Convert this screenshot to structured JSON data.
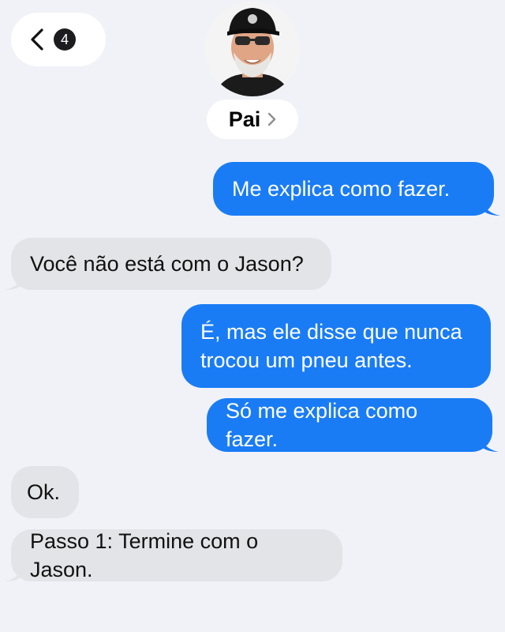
{
  "header": {
    "unread_count": "4",
    "contact_name": "Pai"
  },
  "icons": {
    "back": "chevron-left-icon",
    "contact_details": "chevron-right-icon"
  },
  "colors": {
    "sent_bubble": "#1a7cf5",
    "received_bubble": "#e3e4e8",
    "background": "#f1f2f7"
  },
  "messages": [
    {
      "direction": "sent",
      "text": "Me explica como fazer."
    },
    {
      "direction": "received",
      "text": "Você não está com o Jason?"
    },
    {
      "direction": "sent",
      "lines": [
        "É, mas ele disse que nunca",
        "trocou um pneu antes."
      ]
    },
    {
      "direction": "sent",
      "text": "Só me explica como fazer."
    },
    {
      "direction": "received",
      "text": "Ok."
    },
    {
      "direction": "received",
      "text": "Passo 1: Termine com o Jason."
    }
  ]
}
